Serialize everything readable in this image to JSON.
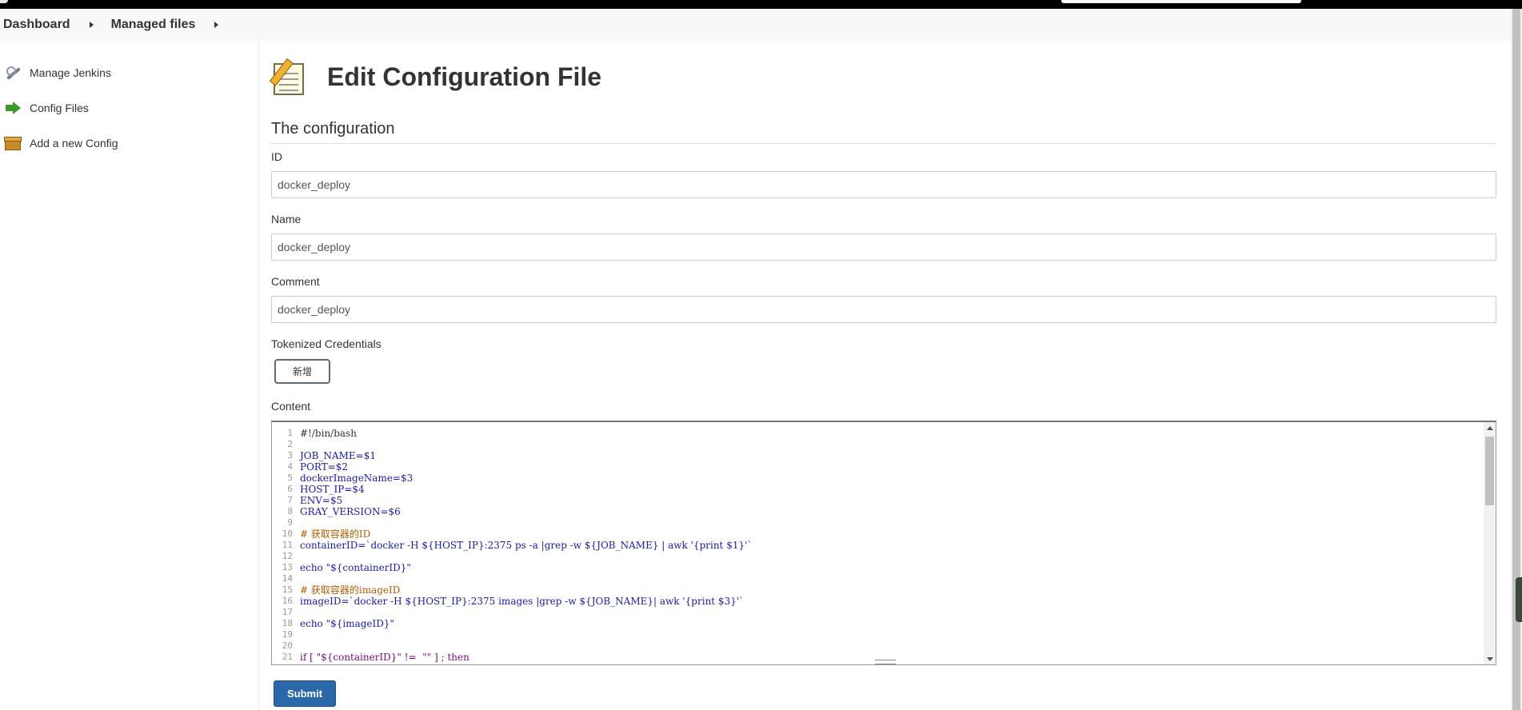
{
  "breadcrumb": {
    "items": [
      "Dashboard",
      "Managed files"
    ]
  },
  "sidebar": {
    "items": [
      {
        "label": "Manage Jenkins",
        "icon": "wrench-icon"
      },
      {
        "label": "Config Files",
        "icon": "green-arrow-icon"
      },
      {
        "label": "Add a new Config",
        "icon": "box-icon"
      }
    ]
  },
  "main": {
    "title": "Edit Configuration File",
    "section_title": "The configuration",
    "id_label": "ID",
    "id_value": "docker_deploy",
    "name_label": "Name",
    "name_value": "docker_deploy",
    "comment_label": "Comment",
    "comment_value": "docker_deploy",
    "tokenized_label": "Tokenized Credentials",
    "add_button": "新增",
    "content_label": "Content",
    "submit_button": "Submit"
  },
  "editor": {
    "lines": [
      {
        "n": "1",
        "text": "#!/bin/bash",
        "kind": "plain"
      },
      {
        "n": "2",
        "text": "",
        "kind": "plain"
      },
      {
        "n": "3",
        "text": "JOB_NAME=$1",
        "kind": "var"
      },
      {
        "n": "4",
        "text": "PORT=$2",
        "kind": "var"
      },
      {
        "n": "5",
        "text": "dockerImageName=$3",
        "kind": "var"
      },
      {
        "n": "6",
        "text": "HOST_IP=$4",
        "kind": "var"
      },
      {
        "n": "7",
        "text": "ENV=$5",
        "kind": "var"
      },
      {
        "n": "8",
        "text": "GRAY_VERSION=$6",
        "kind": "var"
      },
      {
        "n": "9",
        "text": "",
        "kind": "plain"
      },
      {
        "n": "10",
        "text": "# 获取容器的ID",
        "kind": "comment"
      },
      {
        "n": "11",
        "text": "containerID=`docker -H ${HOST_IP}:2375 ps -a |grep -w ${JOB_NAME} | awk '{print $1}'`",
        "kind": "var"
      },
      {
        "n": "12",
        "text": "",
        "kind": "plain"
      },
      {
        "n": "13",
        "text": "echo \"${containerID}\"",
        "kind": "str"
      },
      {
        "n": "14",
        "text": "",
        "kind": "plain"
      },
      {
        "n": "15",
        "text": "# 获取容器的imageID",
        "kind": "comment"
      },
      {
        "n": "16",
        "text": "imageID=`docker -H ${HOST_IP}:2375 images |grep -w ${JOB_NAME}| awk '{print $3}'`",
        "kind": "var"
      },
      {
        "n": "17",
        "text": "",
        "kind": "plain"
      },
      {
        "n": "18",
        "text": "echo \"${imageID}\"",
        "kind": "str"
      },
      {
        "n": "19",
        "text": "",
        "kind": "plain"
      },
      {
        "n": "20",
        "text": "",
        "kind": "plain"
      },
      {
        "n": "21",
        "text": "if [ \"${containerID}\" !=  \"\" ] ; then",
        "kind": "kw"
      }
    ]
  }
}
